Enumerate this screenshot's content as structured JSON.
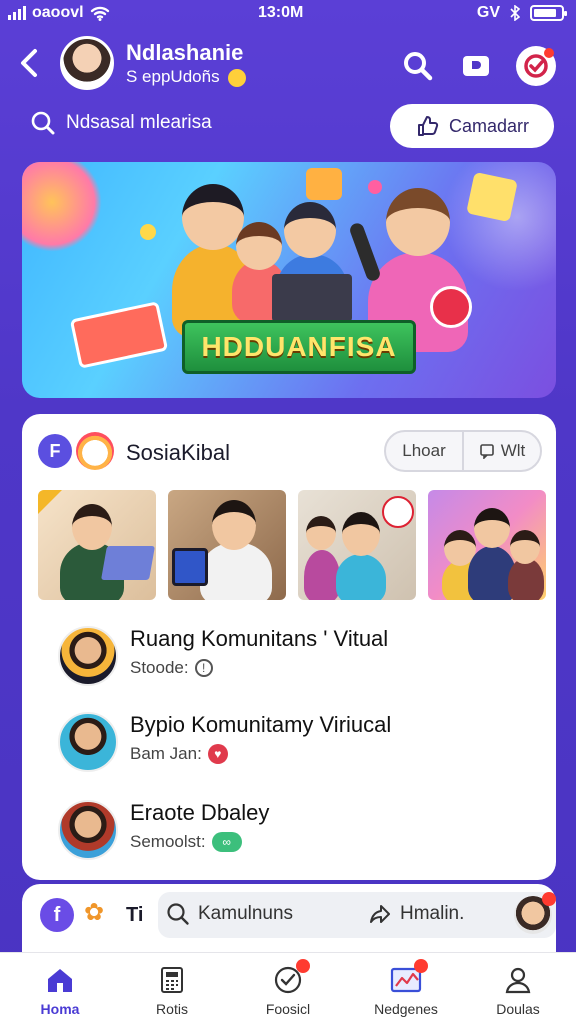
{
  "status_bar": {
    "carrier": "oaoovl",
    "time": "13:0M",
    "right_text": "GV"
  },
  "header": {
    "back_icon": "chevron-left-icon",
    "profile_name": "Ndlashanie",
    "profile_sub": "S eppUdoñs"
  },
  "search_row": {
    "placeholder": "Ndsasal mlearisa",
    "create_label": "Camadarr"
  },
  "banner": {
    "title": "HDDUANFISA"
  },
  "group": {
    "badge": "F",
    "name": "SosiaKibal",
    "segment_left": "Lhoar",
    "segment_right": "Wlt"
  },
  "list": [
    {
      "title": "Ruang Komunitans ' Vitual",
      "sub": "Stoode:"
    },
    {
      "title": "Bypio Komunitamy Viriucal",
      "sub": "Bam Jan:"
    },
    {
      "title": "Eraote Dbaley",
      "sub": "Semoolst:"
    }
  ],
  "card2": {
    "badge": "f",
    "ti": "Ti",
    "search_label": "Kamulnuns",
    "share_label": "Hmalin."
  },
  "nav": [
    {
      "label": "Homa",
      "icon": "home-icon",
      "active": true
    },
    {
      "label": "Rotis",
      "icon": "calculator-icon",
      "active": false
    },
    {
      "label": "Foosicl",
      "icon": "check-circle-icon",
      "active": false
    },
    {
      "label": "Nedgenes",
      "icon": "chart-icon",
      "active": false
    },
    {
      "label": "Doulas",
      "icon": "profile-icon",
      "active": false
    }
  ],
  "colors": {
    "background": "#5b3fd6",
    "accent": "#4a3bd4",
    "badge_red": "#ff3b30"
  }
}
